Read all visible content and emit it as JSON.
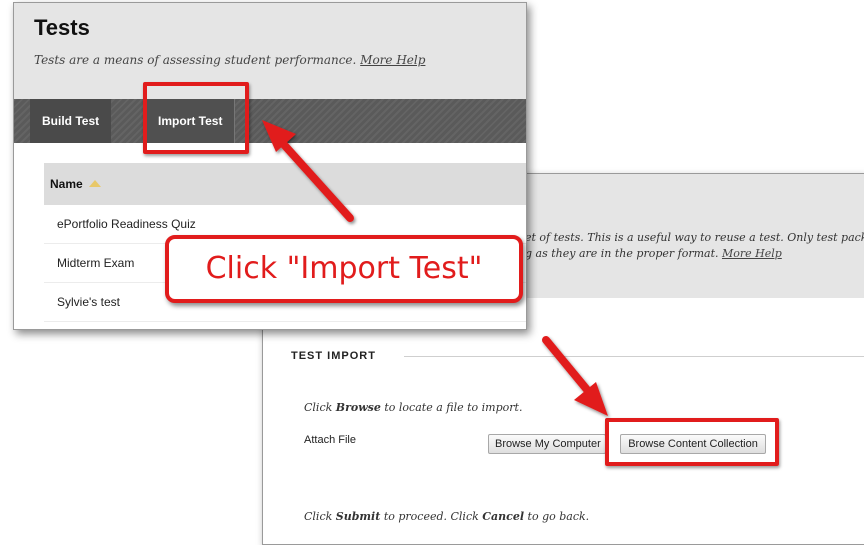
{
  "import_panel": {
    "description_line1": "et of tests. This is a useful way to reuse a test. Only test pack",
    "description_line2_prefix": "g as they are in the proper format. ",
    "description_help": "More Help",
    "section_title": "TEST IMPORT",
    "browse_instruction": {
      "pre": "Click ",
      "bold": "Browse",
      "post": " to locate a file to import."
    },
    "attach_label": "Attach File",
    "browse_computer_label": "Browse My Computer",
    "browse_collection_label": "Browse Content Collection",
    "submit_instruction": {
      "pre": "Click ",
      "submit": "Submit",
      "mid": " to proceed. Click ",
      "cancel": "Cancel",
      "post": " to go back."
    }
  },
  "tests_panel": {
    "title": "Tests",
    "subtitle": "Tests are a means of assessing student performance. ",
    "help_link": "More Help",
    "tabs": [
      {
        "label": "Build Test"
      },
      {
        "label": "Import Test"
      }
    ],
    "list_header": "Name",
    "rows": [
      {
        "name": "ePortfolio Readiness Quiz"
      },
      {
        "name": "Midterm Exam"
      },
      {
        "name": "Sylvie's test"
      }
    ]
  },
  "annotation": {
    "callout_text": "Click \"Import Test\"",
    "color": "#e11c1c"
  },
  "icons": {
    "sort": "sort-ascending-icon"
  }
}
